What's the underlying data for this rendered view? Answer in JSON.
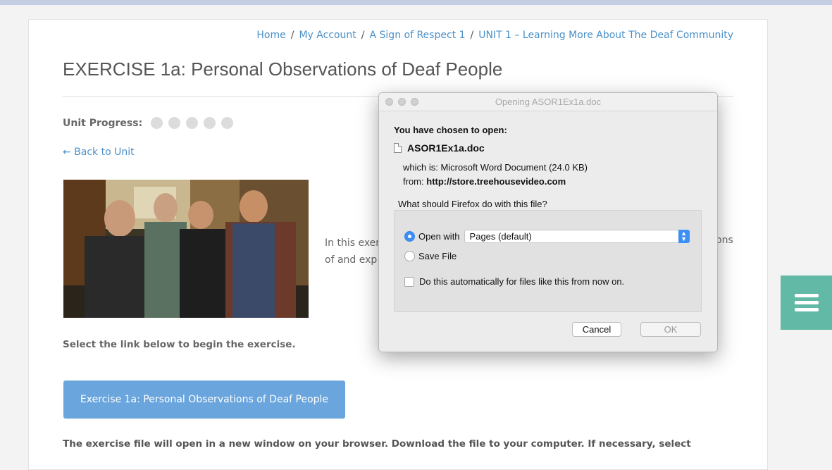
{
  "breadcrumb": {
    "items": [
      "Home",
      "My Account",
      "A Sign of Respect 1",
      "UNIT 1 – Learning More About The Deaf Community"
    ],
    "separator": "/"
  },
  "page": {
    "title": "EXERCISE 1a: Personal Observations of Deaf People",
    "progress_label": "Unit Progress:",
    "progress_total": 5,
    "progress_done": 0,
    "back_link": "← Back to Unit",
    "intro_line1": "In this exer",
    "intro_line1_tail": "ons",
    "intro_line2": "of and exp",
    "select_text": "Select the link below to begin the exercise.",
    "exercise_button": "Exercise 1a: Personal Observations of Deaf People",
    "bottom_text": "The exercise file will open in a new window on your browser.  Download the file to your computer.  If necessary, select"
  },
  "dialog": {
    "title": "Opening ASOR1Ex1a.doc",
    "chosen_label": "You have chosen to open:",
    "file_name": "ASOR1Ex1a.doc",
    "which_is": "which is:  Microsoft Word Document (24.0 KB)",
    "from_label": "from:",
    "from_value": "http://store.treehousevideo.com",
    "question": "What should Firefox do with this file?",
    "open_with_label": "Open with",
    "open_with_value": "Pages (default)",
    "save_file_label": "Save File",
    "auto_label": "Do this automatically for files like this from now on.",
    "cancel_label": "Cancel",
    "ok_label": "OK"
  },
  "colors": {
    "link": "#4a90c8",
    "button": "#6aa5dd",
    "menu": "#62b9a6",
    "accent_radio": "#3e8ff5"
  },
  "icons": {
    "menu": "hamburger-icon",
    "file": "document-icon"
  }
}
